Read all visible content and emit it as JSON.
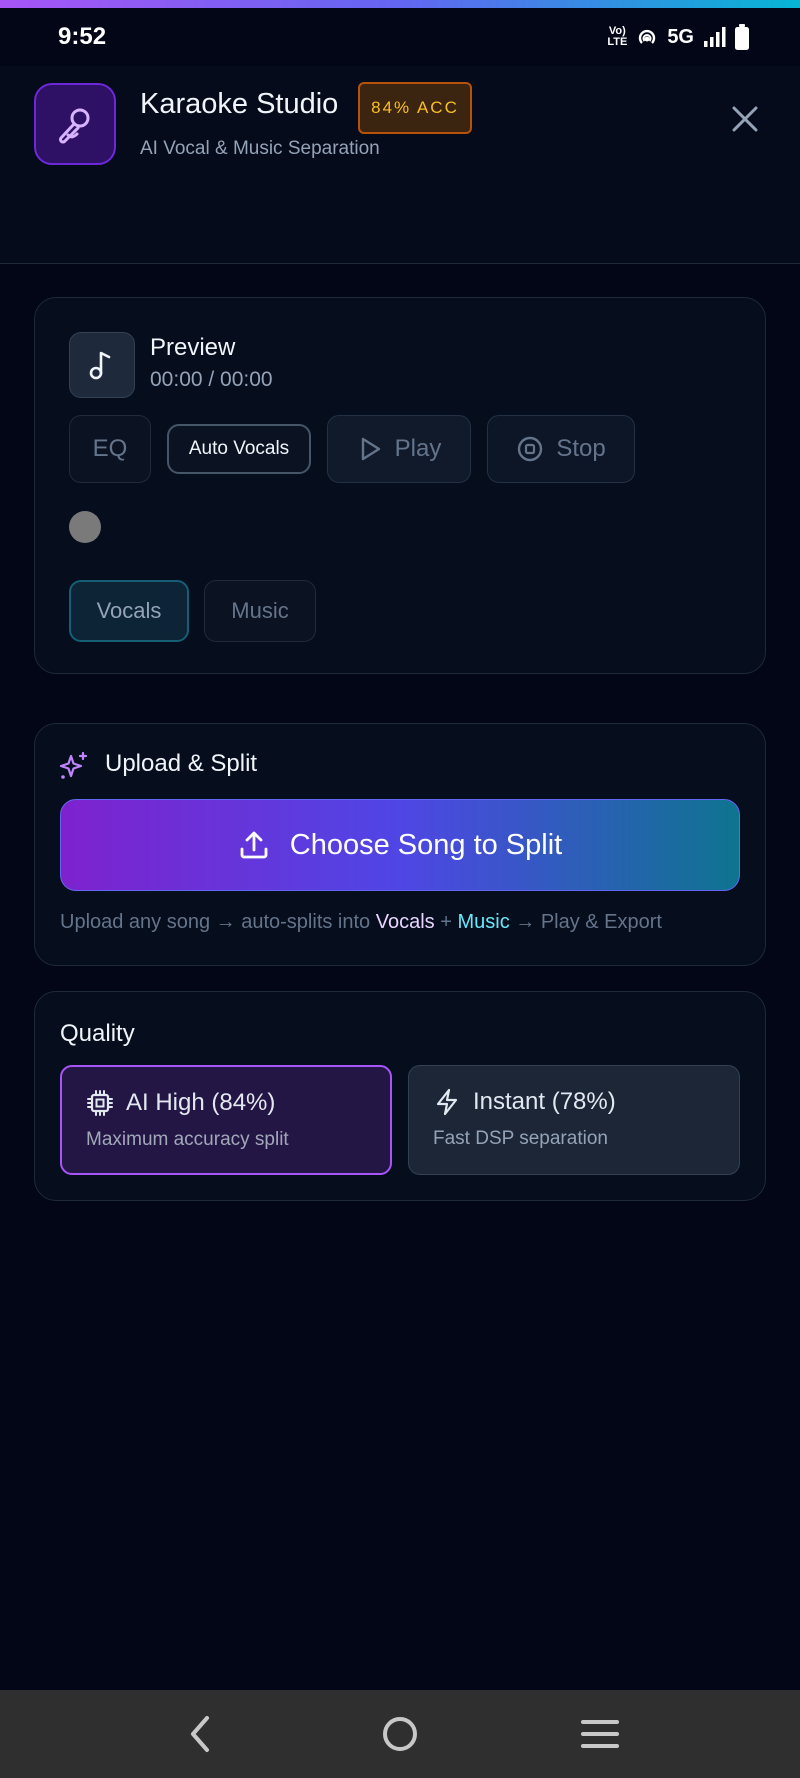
{
  "status_bar": {
    "time": "9:52",
    "volte_label": "Vo) LTE",
    "network_label": "5G",
    "icons": [
      "volte-icon",
      "hotspot-icon",
      "signal-icon",
      "battery-icon"
    ]
  },
  "header": {
    "title": "Karaoke Studio",
    "badge": "84% ACC",
    "subtitle": "AI Vocal & Music Separation",
    "icon": "microphone-icon",
    "close_icon": "close-icon"
  },
  "preview": {
    "title": "Preview",
    "time": "00:00 / 00:00",
    "icon": "music-note-icon",
    "buttons": {
      "eq": "EQ",
      "auto_vocals": "Auto Vocals",
      "play": "Play",
      "stop": "Stop"
    },
    "tracks": {
      "vocals": "Vocals",
      "music": "Music"
    }
  },
  "upload": {
    "title": "Upload & Split",
    "button": "Choose Song to Split",
    "hint_prefix": "Upload any song → auto-splits into ",
    "hint_vocals": "Vocals",
    "hint_plus": " + ",
    "hint_music": "Music",
    "hint_suffix": " → Play & Export"
  },
  "quality": {
    "title": "Quality",
    "options": [
      {
        "label": "AI High (84%)",
        "description": "Maximum accuracy split",
        "icon": "cpu-chip-icon",
        "selected": true
      },
      {
        "label": "Instant (78%)",
        "description": "Fast DSP separation",
        "icon": "lightning-icon",
        "selected": false
      }
    ]
  },
  "colors": {
    "accent_purple": "#a855f7",
    "accent_cyan": "#06b6d4",
    "badge_amber": "#fbbf24",
    "background": "#020617"
  },
  "nav_bar": {
    "icons": [
      "back-icon",
      "home-icon",
      "menu-icon"
    ]
  }
}
